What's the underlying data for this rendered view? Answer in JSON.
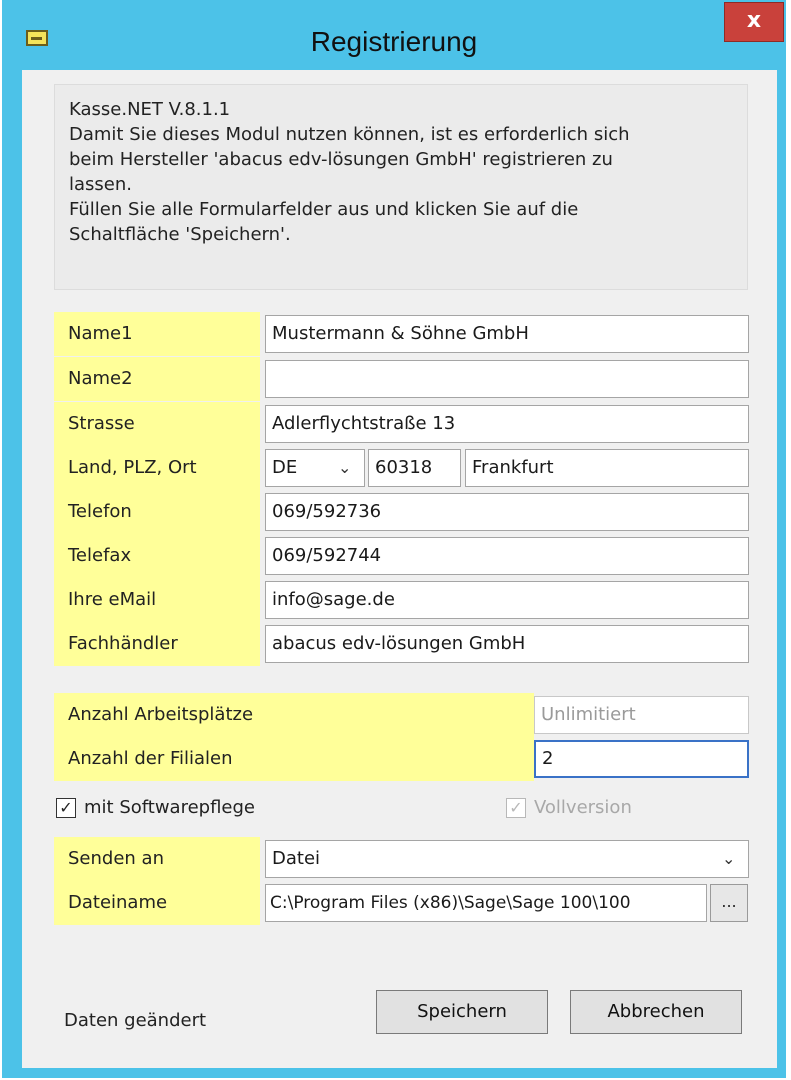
{
  "window": {
    "title": "Registrierung",
    "close_label": "x"
  },
  "info": {
    "lines": [
      "Kasse.NET V.8.1.1",
      "Damit Sie dieses Modul nutzen können, ist es erforderlich sich",
      "beim Hersteller 'abacus edv-lösungen GmbH' registrieren zu",
      "lassen.",
      "Füllen Sie alle Formularfelder aus und klicken Sie auf die",
      "Schaltfläche 'Speichern'."
    ]
  },
  "form": {
    "name1": {
      "label": "Name1",
      "value": "Mustermann & Söhne GmbH"
    },
    "name2": {
      "label": "Name2",
      "value": ""
    },
    "strasse": {
      "label": "Strasse",
      "value": "Adlerflychtstraße 13"
    },
    "land_plz_ort": {
      "label": "Land, PLZ, Ort",
      "land": "DE",
      "plz": "60318",
      "ort": "Frankfurt"
    },
    "telefon": {
      "label": "Telefon",
      "value": "069/592736"
    },
    "telefax": {
      "label": "Telefax",
      "value": "069/592744"
    },
    "email": {
      "label": "Ihre eMail",
      "value": "info@sage.de"
    },
    "fachhaendler": {
      "label": "Fachhändler",
      "value": "abacus edv-lösungen GmbH"
    }
  },
  "license": {
    "arbeitsplaetze": {
      "label": "Anzahl Arbeitsplätze",
      "value": "Unlimitiert"
    },
    "filialen": {
      "label": "Anzahl der Filialen",
      "value": "2"
    },
    "softwarepflege": {
      "label": "mit Softwarepflege",
      "checked": true
    },
    "vollversion": {
      "label": "Vollversion",
      "checked": true,
      "disabled": true
    }
  },
  "send": {
    "senden_an": {
      "label": "Senden an",
      "value": "Datei"
    },
    "dateiname": {
      "label": "Dateiname",
      "value": "C:\\Program Files (x86)\\Sage\\Sage 100\\100",
      "browse_label": "..."
    }
  },
  "footer": {
    "status": "Daten geändert",
    "save_label": "Speichern",
    "cancel_label": "Abbrechen"
  },
  "colors": {
    "title_bar": "#4cc2e8",
    "label_bg": "#ffff99",
    "close_bg": "#c9413b"
  }
}
